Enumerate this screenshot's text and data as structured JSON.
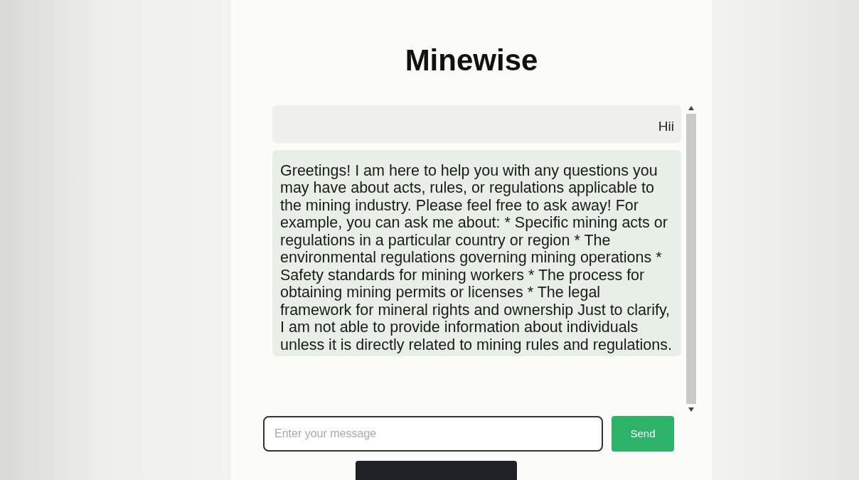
{
  "title": "Minewise",
  "messages": [
    {
      "kind": "user",
      "text": "Hii"
    },
    {
      "kind": "bot",
      "text": "Greetings! I am here to help you with any questions you may have about acts, rules, or regulations applicable to the mining industry. Please feel free to ask away! For example, you can ask me about: * Specific mining acts or regulations in a particular country or region * The environmental regulations governing mining operations * Safety standards for mining workers * The process for obtaining mining permits or licenses * The legal framework for mineral rights and ownership Just to clarify, I am not able to provide information about individuals unless it is directly related to mining rules and regulations."
    }
  ],
  "input": {
    "placeholder": "Enter your message"
  },
  "send_button": "Send"
}
